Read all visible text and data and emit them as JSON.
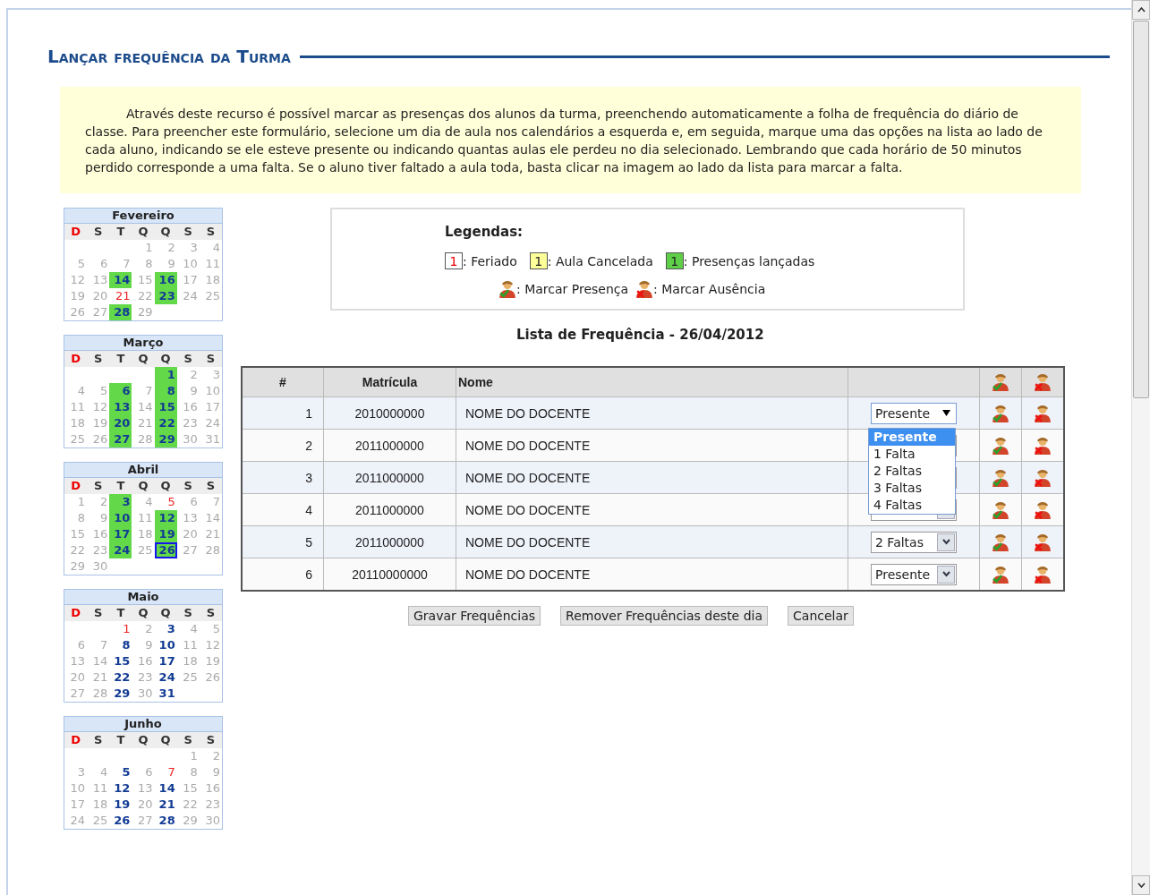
{
  "title": "Lançar frequência da Turma",
  "intro": "Através deste recurso é possível marcar as presenças dos alunos da turma, preenchendo automaticamente a folha de frequência do diário de classe. Para preencher este formulário, selecione um dia de aula nos calendários a esquerda e, em seguida, marque uma das opções na lista ao lado de cada aluno, indicando se ele esteve presente ou indicando quantas aulas ele perdeu no dia selecionado. Lembrando que cada horário de 50 minutos perdido corresponde a uma falta. Se o aluno tiver faltado a aula toda, basta clicar na imagem ao lado da lista para marcar a falta.",
  "calendars": [
    {
      "month": "Fevereiro",
      "weekdays": [
        "D",
        "S",
        "T",
        "Q",
        "Q",
        "S",
        "S"
      ],
      "weeks": [
        [
          {
            "kind": "empty"
          },
          {
            "kind": "empty"
          },
          {
            "kind": "empty"
          },
          {
            "day": "1",
            "kind": "plain"
          },
          {
            "day": "2",
            "kind": "plain"
          },
          {
            "day": "3",
            "kind": "plain"
          },
          {
            "day": "4",
            "kind": "plain"
          }
        ],
        [
          {
            "day": "5",
            "kind": "plain"
          },
          {
            "day": "6",
            "kind": "plain"
          },
          {
            "day": "7",
            "kind": "plain"
          },
          {
            "day": "8",
            "kind": "plain"
          },
          {
            "day": "9",
            "kind": "plain"
          },
          {
            "day": "10",
            "kind": "plain"
          },
          {
            "day": "11",
            "kind": "plain"
          }
        ],
        [
          {
            "day": "12",
            "kind": "plain"
          },
          {
            "day": "13",
            "kind": "plain"
          },
          {
            "day": "14",
            "kind": "recorded"
          },
          {
            "day": "15",
            "kind": "plain"
          },
          {
            "day": "16",
            "kind": "recorded"
          },
          {
            "day": "17",
            "kind": "plain"
          },
          {
            "day": "18",
            "kind": "plain"
          }
        ],
        [
          {
            "day": "19",
            "kind": "plain"
          },
          {
            "day": "20",
            "kind": "plain"
          },
          {
            "day": "21",
            "kind": "holiday"
          },
          {
            "day": "22",
            "kind": "plain"
          },
          {
            "day": "23",
            "kind": "recorded"
          },
          {
            "day": "24",
            "kind": "plain"
          },
          {
            "day": "25",
            "kind": "plain"
          }
        ],
        [
          {
            "day": "26",
            "kind": "plain"
          },
          {
            "day": "27",
            "kind": "plain"
          },
          {
            "day": "28",
            "kind": "recorded"
          },
          {
            "day": "29",
            "kind": "plain"
          }
        ]
      ]
    },
    {
      "month": "Março",
      "weekdays": [
        "D",
        "S",
        "T",
        "Q",
        "Q",
        "S",
        "S"
      ],
      "weeks": [
        [
          {
            "kind": "empty"
          },
          {
            "kind": "empty"
          },
          {
            "kind": "empty"
          },
          {
            "kind": "empty"
          },
          {
            "day": "1",
            "kind": "recorded"
          },
          {
            "day": "2",
            "kind": "plain"
          },
          {
            "day": "3",
            "kind": "plain"
          }
        ],
        [
          {
            "day": "4",
            "kind": "plain"
          },
          {
            "day": "5",
            "kind": "plain"
          },
          {
            "day": "6",
            "kind": "recorded"
          },
          {
            "day": "7",
            "kind": "plain"
          },
          {
            "day": "8",
            "kind": "recorded"
          },
          {
            "day": "9",
            "kind": "plain"
          },
          {
            "day": "10",
            "kind": "plain"
          }
        ],
        [
          {
            "day": "11",
            "kind": "plain"
          },
          {
            "day": "12",
            "kind": "plain"
          },
          {
            "day": "13",
            "kind": "recorded"
          },
          {
            "day": "14",
            "kind": "plain"
          },
          {
            "day": "15",
            "kind": "recorded"
          },
          {
            "day": "16",
            "kind": "plain"
          },
          {
            "day": "17",
            "kind": "plain"
          }
        ],
        [
          {
            "day": "18",
            "kind": "plain"
          },
          {
            "day": "19",
            "kind": "plain"
          },
          {
            "day": "20",
            "kind": "recorded"
          },
          {
            "day": "21",
            "kind": "plain"
          },
          {
            "day": "22",
            "kind": "recorded"
          },
          {
            "day": "23",
            "kind": "plain"
          },
          {
            "day": "24",
            "kind": "plain"
          }
        ],
        [
          {
            "day": "25",
            "kind": "plain"
          },
          {
            "day": "26",
            "kind": "plain"
          },
          {
            "day": "27",
            "kind": "recorded"
          },
          {
            "day": "28",
            "kind": "plain"
          },
          {
            "day": "29",
            "kind": "recorded"
          },
          {
            "day": "30",
            "kind": "plain"
          },
          {
            "day": "31",
            "kind": "plain"
          }
        ]
      ]
    },
    {
      "month": "Abril",
      "weekdays": [
        "D",
        "S",
        "T",
        "Q",
        "Q",
        "S",
        "S"
      ],
      "weeks": [
        [
          {
            "day": "1",
            "kind": "plain"
          },
          {
            "day": "2",
            "kind": "plain"
          },
          {
            "day": "3",
            "kind": "recorded"
          },
          {
            "day": "4",
            "kind": "plain"
          },
          {
            "day": "5",
            "kind": "holiday"
          },
          {
            "day": "6",
            "kind": "plain"
          },
          {
            "day": "7",
            "kind": "plain"
          }
        ],
        [
          {
            "day": "8",
            "kind": "plain"
          },
          {
            "day": "9",
            "kind": "plain"
          },
          {
            "day": "10",
            "kind": "recorded"
          },
          {
            "day": "11",
            "kind": "plain"
          },
          {
            "day": "12",
            "kind": "recorded"
          },
          {
            "day": "13",
            "kind": "plain"
          },
          {
            "day": "14",
            "kind": "plain"
          }
        ],
        [
          {
            "day": "15",
            "kind": "plain"
          },
          {
            "day": "16",
            "kind": "plain"
          },
          {
            "day": "17",
            "kind": "recorded"
          },
          {
            "day": "18",
            "kind": "plain"
          },
          {
            "day": "19",
            "kind": "recorded"
          },
          {
            "day": "20",
            "kind": "plain"
          },
          {
            "day": "21",
            "kind": "plain"
          }
        ],
        [
          {
            "day": "22",
            "kind": "plain"
          },
          {
            "day": "23",
            "kind": "plain"
          },
          {
            "day": "24",
            "kind": "recorded"
          },
          {
            "day": "25",
            "kind": "plain"
          },
          {
            "day": "26",
            "kind": "recorded",
            "selected": true
          },
          {
            "day": "27",
            "kind": "plain"
          },
          {
            "day": "28",
            "kind": "plain"
          }
        ],
        [
          {
            "day": "29",
            "kind": "plain"
          },
          {
            "day": "30",
            "kind": "plain"
          }
        ]
      ]
    },
    {
      "month": "Maio",
      "weekdays": [
        "D",
        "S",
        "T",
        "Q",
        "Q",
        "S",
        "S"
      ],
      "weeks": [
        [
          {
            "kind": "empty"
          },
          {
            "kind": "empty"
          },
          {
            "day": "1",
            "kind": "holiday"
          },
          {
            "day": "2",
            "kind": "plain"
          },
          {
            "day": "3",
            "kind": "class"
          },
          {
            "day": "4",
            "kind": "plain"
          },
          {
            "day": "5",
            "kind": "plain"
          }
        ],
        [
          {
            "day": "6",
            "kind": "plain"
          },
          {
            "day": "7",
            "kind": "plain"
          },
          {
            "day": "8",
            "kind": "class"
          },
          {
            "day": "9",
            "kind": "plain"
          },
          {
            "day": "10",
            "kind": "class"
          },
          {
            "day": "11",
            "kind": "plain"
          },
          {
            "day": "12",
            "kind": "plain"
          }
        ],
        [
          {
            "day": "13",
            "kind": "plain"
          },
          {
            "day": "14",
            "kind": "plain"
          },
          {
            "day": "15",
            "kind": "class"
          },
          {
            "day": "16",
            "kind": "plain"
          },
          {
            "day": "17",
            "kind": "class"
          },
          {
            "day": "18",
            "kind": "plain"
          },
          {
            "day": "19",
            "kind": "plain"
          }
        ],
        [
          {
            "day": "20",
            "kind": "plain"
          },
          {
            "day": "21",
            "kind": "plain"
          },
          {
            "day": "22",
            "kind": "class"
          },
          {
            "day": "23",
            "kind": "plain"
          },
          {
            "day": "24",
            "kind": "class"
          },
          {
            "day": "25",
            "kind": "plain"
          },
          {
            "day": "26",
            "kind": "plain"
          }
        ],
        [
          {
            "day": "27",
            "kind": "plain"
          },
          {
            "day": "28",
            "kind": "plain"
          },
          {
            "day": "29",
            "kind": "class"
          },
          {
            "day": "30",
            "kind": "plain"
          },
          {
            "day": "31",
            "kind": "class"
          }
        ]
      ]
    },
    {
      "month": "Junho",
      "weekdays": [
        "D",
        "S",
        "T",
        "Q",
        "Q",
        "S",
        "S"
      ],
      "weeks": [
        [
          {
            "kind": "empty"
          },
          {
            "kind": "empty"
          },
          {
            "kind": "empty"
          },
          {
            "kind": "empty"
          },
          {
            "kind": "empty"
          },
          {
            "day": "1",
            "kind": "plain"
          },
          {
            "day": "2",
            "kind": "plain"
          }
        ],
        [
          {
            "day": "3",
            "kind": "plain"
          },
          {
            "day": "4",
            "kind": "plain"
          },
          {
            "day": "5",
            "kind": "class"
          },
          {
            "day": "6",
            "kind": "plain"
          },
          {
            "day": "7",
            "kind": "holiday"
          },
          {
            "day": "8",
            "kind": "plain"
          },
          {
            "day": "9",
            "kind": "plain"
          }
        ],
        [
          {
            "day": "10",
            "kind": "plain"
          },
          {
            "day": "11",
            "kind": "plain"
          },
          {
            "day": "12",
            "kind": "class"
          },
          {
            "day": "13",
            "kind": "plain"
          },
          {
            "day": "14",
            "kind": "class"
          },
          {
            "day": "15",
            "kind": "plain"
          },
          {
            "day": "16",
            "kind": "plain"
          }
        ],
        [
          {
            "day": "17",
            "kind": "plain"
          },
          {
            "day": "18",
            "kind": "plain"
          },
          {
            "day": "19",
            "kind": "class"
          },
          {
            "day": "20",
            "kind": "plain"
          },
          {
            "day": "21",
            "kind": "class"
          },
          {
            "day": "22",
            "kind": "plain"
          },
          {
            "day": "23",
            "kind": "plain"
          }
        ],
        [
          {
            "day": "24",
            "kind": "plain"
          },
          {
            "day": "25",
            "kind": "plain"
          },
          {
            "day": "26",
            "kind": "class"
          },
          {
            "day": "27",
            "kind": "plain"
          },
          {
            "day": "28",
            "kind": "class"
          },
          {
            "day": "29",
            "kind": "plain"
          },
          {
            "day": "30",
            "kind": "plain"
          }
        ]
      ]
    }
  ],
  "legend": {
    "title": "Legendas:",
    "items": [
      {
        "kind": "holiday",
        "sample": "1",
        "label": ": Feriado"
      },
      {
        "kind": "cancelled",
        "sample": "1",
        "label": ": Aula Cancelada"
      },
      {
        "kind": "recorded",
        "sample": "1",
        "label": ": Presenças lançadas"
      }
    ],
    "icons": [
      {
        "kind": "present",
        "label": ": Marcar Presença"
      },
      {
        "kind": "absent",
        "label": ": Marcar Ausência"
      }
    ]
  },
  "list_title": "Lista de Frequência - 26/04/2012",
  "table": {
    "columns": [
      "#",
      "Matrícula",
      "Nome"
    ],
    "rows": [
      {
        "number": "1",
        "matricula": "2010000000",
        "name": "NOME DO DOCENTE",
        "value": "Presente",
        "expanded": true
      },
      {
        "number": "2",
        "matricula": "2011000000",
        "name": "NOME DO DOCENTE",
        "expanded": false
      },
      {
        "number": "3",
        "matricula": "2011000000",
        "name": "NOME DO DOCENTE",
        "expanded": false
      },
      {
        "number": "4",
        "matricula": "2011000000",
        "name": "NOME DO DOCENTE",
        "expanded": false
      },
      {
        "number": "5",
        "matricula": "2011000000",
        "name": "NOME DO DOCENTE",
        "value": "2 Faltas",
        "expanded": false
      },
      {
        "number": "6",
        "matricula": "20110000000",
        "name": "NOME DO DOCENTE",
        "value": "Presente",
        "expanded": false
      }
    ],
    "dropdown_options": [
      {
        "label": "Presente",
        "selected": true
      },
      {
        "label": "1 Falta",
        "selected": false
      },
      {
        "label": "2 Faltas",
        "selected": false
      },
      {
        "label": "3 Faltas",
        "selected": false
      },
      {
        "label": "4 Faltas",
        "selected": false
      }
    ]
  },
  "buttons": [
    "Gravar Frequências",
    "Remover Frequências deste dia",
    "Cancelar"
  ]
}
